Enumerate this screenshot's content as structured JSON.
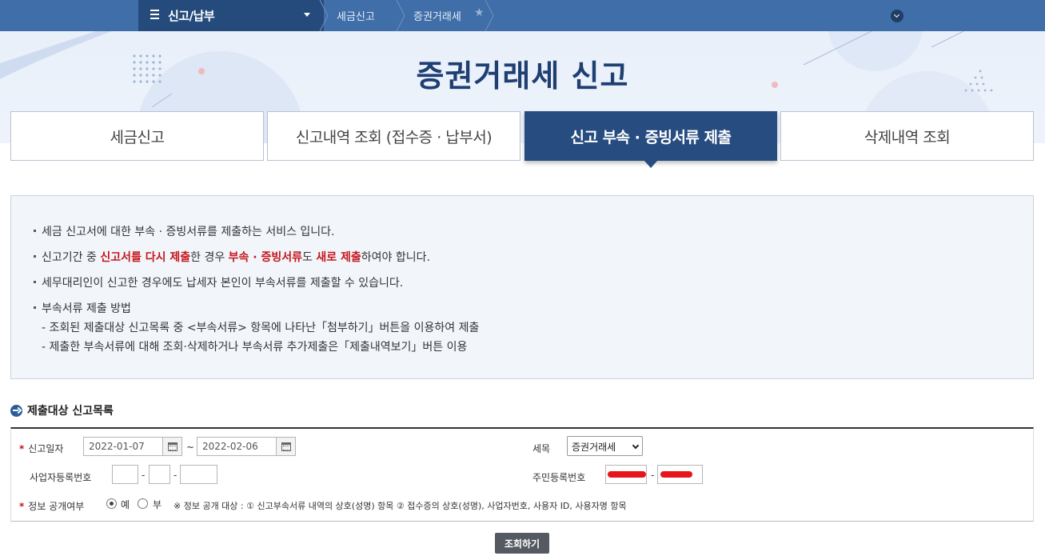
{
  "nav": {
    "menu_label": "신고/납부",
    "crumbs": [
      "세금신고",
      "증권거래세"
    ]
  },
  "title": "증권거래세 신고",
  "tabs": [
    {
      "label": "세금신고",
      "active": false
    },
    {
      "label": "신고내역 조회 (접수증 · 납부서)",
      "active": false
    },
    {
      "label": "신고 부속 · 증빙서류 제출",
      "active": true
    },
    {
      "label": "삭제내역 조회",
      "active": false
    }
  ],
  "info": {
    "line1": "세금 신고서에 대한 부속 · 증빙서류를 제출하는 서비스 입니다.",
    "line2_a": "신고기간 중 ",
    "line2_b": "신고서를 다시 제출",
    "line2_c": "한 경우 ",
    "line2_d": "부속 · 증빙서류",
    "line2_e": "도 ",
    "line2_f": "새로 제출",
    "line2_g": "하여야 합니다.",
    "line3": "세무대리인이 신고한 경우에도 납세자 본인이 부속서류를 제출할 수 있습니다.",
    "line4": "부속서류 제출 방법",
    "sub1": "- 조회된 제출대상 신고목록 중 <부속서류> 항목에 나타난「첨부하기」버튼을 이용하여 제출",
    "sub2": "- 제출한 부속서류에 대해 조회·삭제하거나 부속서류 추가제출은「제출내역보기」버튼 이용"
  },
  "section_title": "제출대상 신고목록",
  "form": {
    "date_label": "신고일자",
    "date_from": "2022-01-07",
    "date_to": "2022-02-06",
    "tilde": "~",
    "tax_label": "세목",
    "tax_value": "증권거래세",
    "bizno_label": "사업자등록번호",
    "resno_label": "주민등록번호",
    "dash": "-",
    "public_label": "정보 공개여부",
    "radio_yes": "예",
    "radio_no": "부",
    "note": "※ 정보 공개 대상 : ① 신고부속서류 내역의 상호(성명) 항목 ② 접수증의 상호(성명), 사업자번호, 사용자 ID, 사용자명 항목"
  },
  "search_button": "조회하기",
  "colors": {
    "nav_bg": "#3f6ea8",
    "nav_dark": "#254b7c",
    "title": "#1f3f73",
    "tab_active": "#264c80",
    "highlight": "#c4161c"
  }
}
